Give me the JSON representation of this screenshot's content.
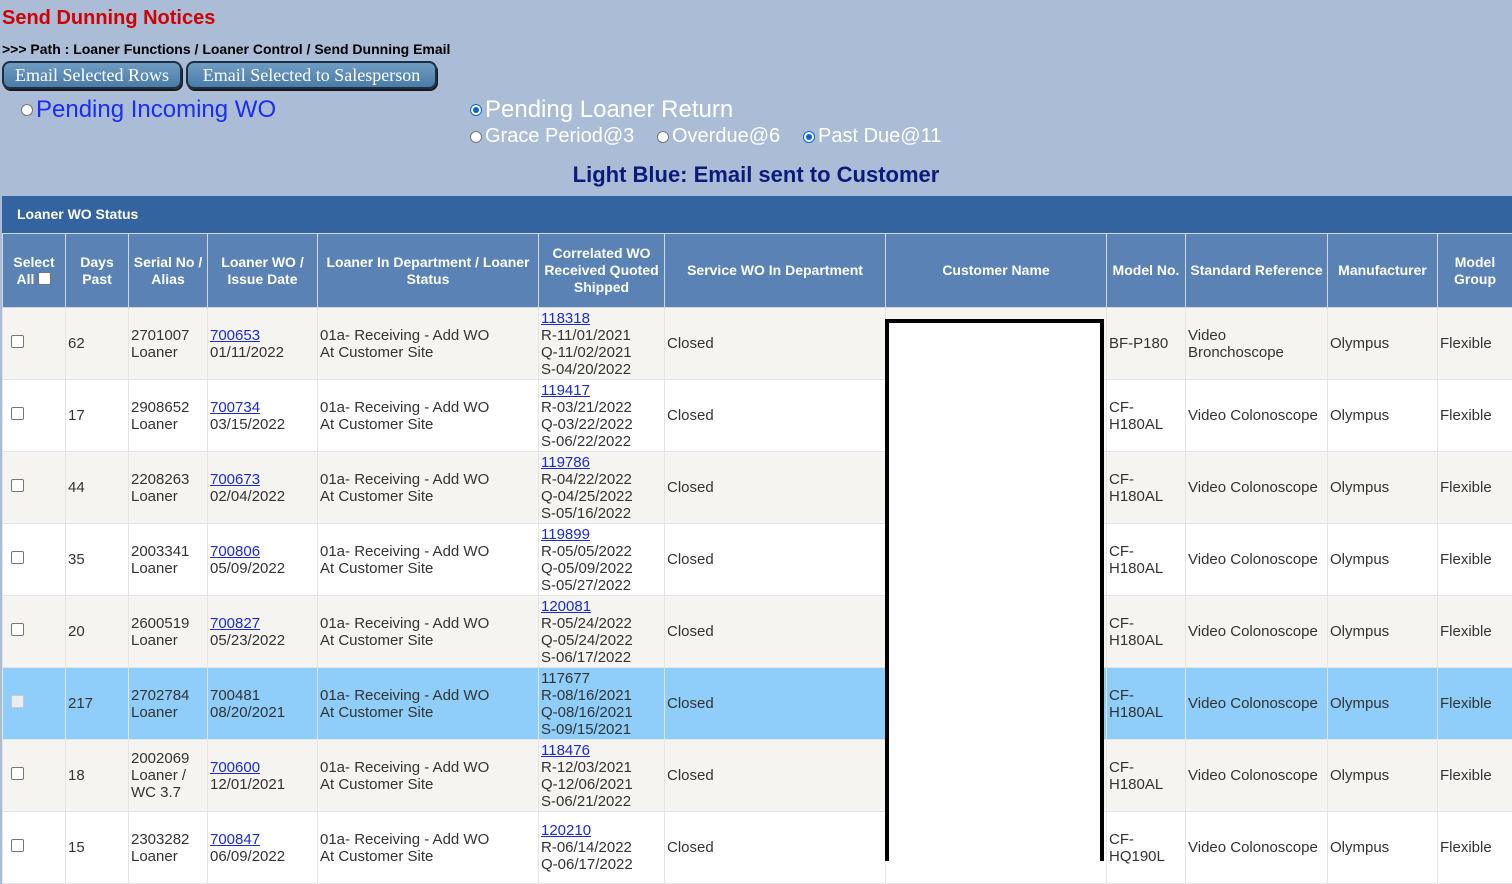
{
  "header": {
    "title": "Send Dunning Notices",
    "path": ">>> Path : Loaner Functions / Loaner Control / Send Dunning Email"
  },
  "toolbar": {
    "email_selected_rows": "Email Selected Rows",
    "email_selected_to_salesperson": "Email Selected to Salesperson"
  },
  "filters": {
    "pending_incoming_wo": "Pending Incoming WO",
    "pending_loaner_return": "Pending Loaner Return",
    "grace_period": "Grace Period@3",
    "overdue": "Overdue@6",
    "past_due": "Past Due@11",
    "selected_main": "Pending Loaner Return",
    "selected_sub": "Past Due@11"
  },
  "legend": "Light Blue: Email sent to Customer",
  "section_title": "Loaner WO Status",
  "columns": {
    "select_all": "Select All",
    "days_past": "Days Past",
    "serial": "Serial No / Alias",
    "loaner_wo": "Loaner WO / Issue Date",
    "loaner_dept": "Loaner In Department / Loaner Status",
    "correlated": "Correlated WO Received Quoted Shipped",
    "service_dept": "Service WO In Department",
    "customer": "Customer Name",
    "model": "Model No.",
    "standard": "Standard Reference",
    "manufacturer": "Manufacturer",
    "model_group": "Model Group"
  },
  "rows": [
    {
      "days": "62",
      "serial": "2701007",
      "alias": "Loaner",
      "wo": "700653",
      "issue": "01/11/2022",
      "dept": "01a- Receiving - Add WO",
      "status": "At Customer Site",
      "cwo": "118318",
      "r": "R-11/01/2021",
      "q": "Q-11/02/2021",
      "s": "S-04/20/2022",
      "service": "Closed",
      "customer": "",
      "model": "BF-P180",
      "standard": "Video Bronchoscope",
      "mfr": "Olympus",
      "group": "Flexible",
      "highlight": false
    },
    {
      "days": "17",
      "serial": "2908652",
      "alias": "Loaner",
      "wo": "700734",
      "issue": "03/15/2022",
      "dept": "01a- Receiving - Add WO",
      "status": "At Customer Site",
      "cwo": "119417",
      "r": "R-03/21/2022",
      "q": "Q-03/22/2022",
      "s": "S-06/22/2022",
      "service": "Closed",
      "customer": "",
      "model": "CF-H180AL",
      "standard": "Video Colonoscope",
      "mfr": "Olympus",
      "group": "Flexible",
      "highlight": false
    },
    {
      "days": "44",
      "serial": "2208263",
      "alias": "Loaner",
      "wo": "700673",
      "issue": "02/04/2022",
      "dept": "01a- Receiving - Add WO",
      "status": "At Customer Site",
      "cwo": "119786",
      "r": "R-04/22/2022",
      "q": "Q-04/25/2022",
      "s": "S-05/16/2022",
      "service": "Closed",
      "customer": "",
      "model": "CF-H180AL",
      "standard": "Video Colonoscope",
      "mfr": "Olympus",
      "group": "Flexible",
      "highlight": false
    },
    {
      "days": "35",
      "serial": "2003341",
      "alias": "Loaner",
      "wo": "700806",
      "issue": "05/09/2022",
      "dept": "01a- Receiving - Add WO",
      "status": "At Customer Site",
      "cwo": "119899",
      "r": "R-05/05/2022",
      "q": "Q-05/09/2022",
      "s": "S-05/27/2022",
      "service": "Closed",
      "customer": "",
      "model": "CF-H180AL",
      "standard": "Video Colonoscope",
      "mfr": "Olympus",
      "group": "Flexible",
      "highlight": false
    },
    {
      "days": "20",
      "serial": "2600519",
      "alias": "Loaner",
      "wo": "700827",
      "issue": "05/23/2022",
      "dept": "01a- Receiving - Add WO",
      "status": "At Customer Site",
      "cwo": "120081",
      "r": "R-05/24/2022",
      "q": "Q-05/24/2022",
      "s": "S-06/17/2022",
      "service": "Closed",
      "customer": "",
      "model": "CF-H180AL",
      "standard": "Video Colonoscope",
      "mfr": "Olympus",
      "group": "Flexible",
      "highlight": false
    },
    {
      "days": "217",
      "serial": "2702784",
      "alias": "Loaner",
      "wo": "700481",
      "issue": "08/20/2021",
      "dept": "01a- Receiving - Add WO",
      "status": "At Customer Site",
      "cwo": "117677",
      "r": "R-08/16/2021",
      "q": "Q-08/16/2021",
      "s": "S-09/15/2021",
      "service": "Closed",
      "customer": "",
      "model": "CF-H180AL",
      "standard": "Video Colonoscope",
      "mfr": "Olympus",
      "group": "Flexible",
      "highlight": true
    },
    {
      "days": "18",
      "serial": "2002069",
      "alias": "Loaner / WC 3.7",
      "wo": "700600",
      "issue": "12/01/2021",
      "dept": "01a- Receiving - Add WO",
      "status": "At Customer Site",
      "cwo": "118476",
      "r": "R-12/03/2021",
      "q": "Q-12/06/2021",
      "s": "S-06/21/2022",
      "service": "Closed",
      "customer": "",
      "model": "CF-H180AL",
      "standard": "Video Colonoscope",
      "mfr": "Olympus",
      "group": "Flexible",
      "highlight": false
    },
    {
      "days": "15",
      "serial": "2303282",
      "alias": "Loaner",
      "wo": "700847",
      "issue": "06/09/2022",
      "dept": "01a- Receiving - Add WO",
      "status": "At Customer Site",
      "cwo": "120210",
      "r": "R-06/14/2022",
      "q": "Q-06/17/2022",
      "s": "",
      "service": "Closed",
      "customer": "",
      "model": "CF-HQ190L",
      "standard": "Video Colonoscope",
      "mfr": "Olympus",
      "group": "Flexible",
      "highlight": false
    }
  ],
  "colors": {
    "page_bg": "#aabcd6",
    "title_red": "#cc0000",
    "header_bar": "#3464a0",
    "column_header": "#5a82b4",
    "highlight_row": "#8fcdfa"
  }
}
